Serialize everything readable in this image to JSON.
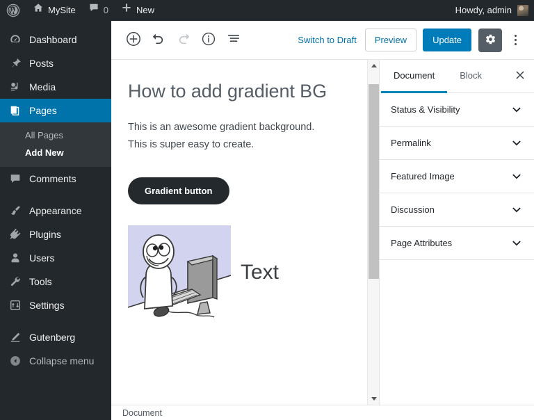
{
  "adminbar": {
    "logo_icon": "wordpress-logo-icon",
    "site_name": "MySite",
    "home_icon": "home-icon",
    "comments_icon": "comment-bubble-icon",
    "comment_count": "0",
    "new_icon": "plus-icon",
    "new_label": "New",
    "howdy": "Howdy, admin",
    "avatar_icon": "user-avatar"
  },
  "sidebar": {
    "items": [
      {
        "label": "Dashboard",
        "icon": "dashboard-icon",
        "current": false
      },
      {
        "label": "Posts",
        "icon": "pin-icon",
        "current": false
      },
      {
        "label": "Media",
        "icon": "media-icon",
        "current": false
      },
      {
        "label": "Pages",
        "icon": "pages-icon",
        "current": true
      },
      {
        "label": "Comments",
        "icon": "comment-bubble-icon",
        "current": false
      },
      {
        "label": "Appearance",
        "icon": "paintbrush-icon",
        "current": false
      },
      {
        "label": "Plugins",
        "icon": "plug-icon",
        "current": false
      },
      {
        "label": "Users",
        "icon": "user-icon",
        "current": false
      },
      {
        "label": "Tools",
        "icon": "wrench-icon",
        "current": false
      },
      {
        "label": "Settings",
        "icon": "settings-sliders-icon",
        "current": false
      },
      {
        "label": "Gutenberg",
        "icon": "pencil-icon",
        "current": false
      },
      {
        "label": "Collapse menu",
        "icon": "collapse-arrow-icon",
        "current": false
      }
    ],
    "submenu": {
      "all_pages": "All Pages",
      "add_new": "Add New"
    }
  },
  "toolbar": {
    "add_block_icon": "plus-circle-icon",
    "undo_icon": "undo-arrow-icon",
    "redo_icon": "redo-arrow-icon",
    "info_icon": "info-circle-icon",
    "block_navigation_icon": "block-list-icon",
    "switch_to_draft": "Switch to Draft",
    "preview": "Preview",
    "update": "Update",
    "settings_gear_icon": "gear-icon",
    "more_menu_icon": "vertical-ellipsis-icon",
    "accent_blue": "#007cba",
    "link_blue": "#0073aa"
  },
  "editor": {
    "title": "How to add gradient BG",
    "paragraph_line1": "This is an awesome gradient background.",
    "paragraph_line2": "This is super easy to create.",
    "gradient_button_label": "Gradient button",
    "gradient_button_bg": "#24292d",
    "media_text_label": "Text",
    "image_alt": "meme-illustration",
    "image_bg": "#d2d4ef"
  },
  "settings_panel": {
    "tabs": [
      {
        "label": "Document",
        "active": true
      },
      {
        "label": "Block",
        "active": false
      }
    ],
    "close_icon": "close-icon",
    "panels": [
      {
        "label": "Status & Visibility",
        "icon": "chevron-down-icon"
      },
      {
        "label": "Permalink",
        "icon": "chevron-down-icon"
      },
      {
        "label": "Featured Image",
        "icon": "chevron-down-icon"
      },
      {
        "label": "Discussion",
        "icon": "chevron-down-icon"
      },
      {
        "label": "Page Attributes",
        "icon": "chevron-down-icon"
      }
    ],
    "active_tab_color": "#0085ba"
  },
  "statusbar": {
    "breadcrumb": "Document"
  },
  "scrollbar": {
    "up_icon": "scroll-up-arrow-icon",
    "down_icon": "scroll-down-arrow-icon"
  }
}
